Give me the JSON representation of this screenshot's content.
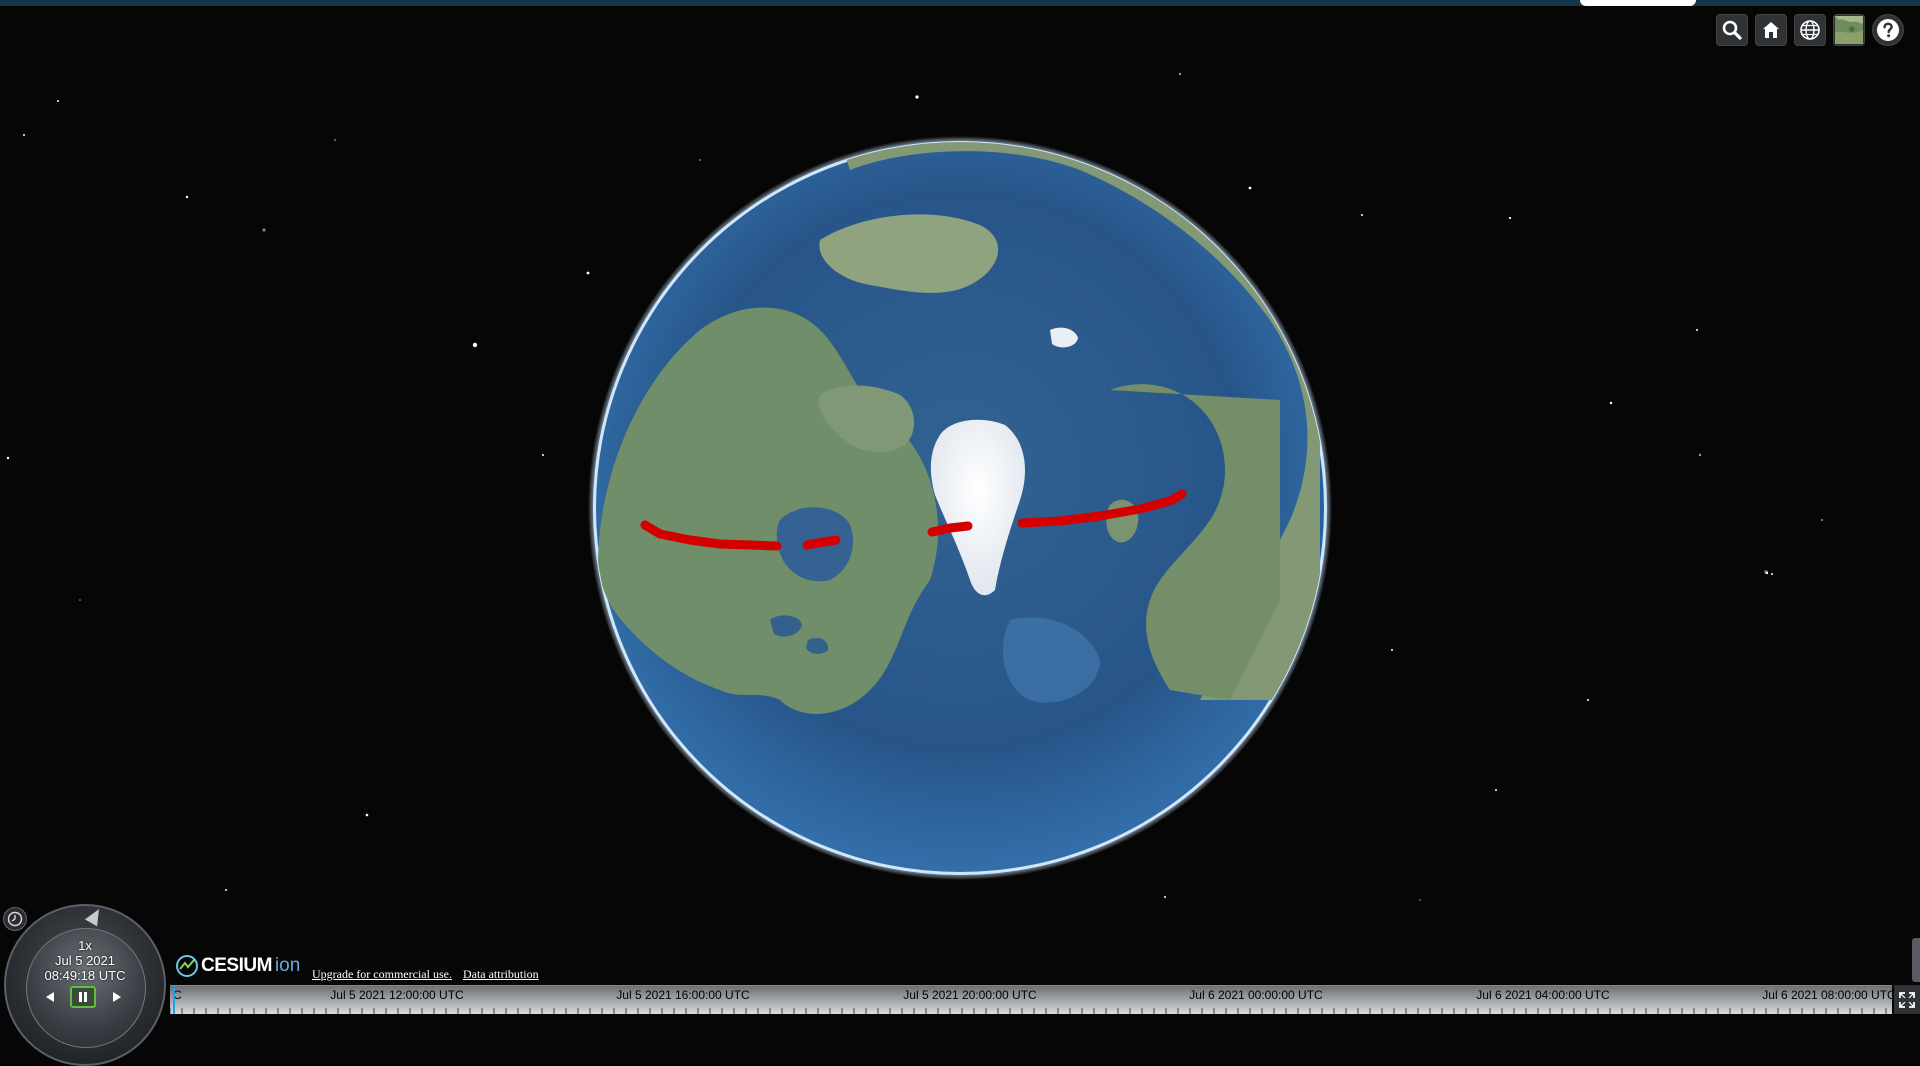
{
  "toolbar": {
    "buttons": [
      {
        "name": "search-button",
        "icon": "search-icon"
      },
      {
        "name": "home-button",
        "icon": "home-icon"
      },
      {
        "name": "scene-mode-button",
        "icon": "globe-icon"
      },
      {
        "name": "base-layer-picker-button",
        "icon": "imagery-thumbnail-icon"
      },
      {
        "name": "help-button",
        "icon": "question-icon"
      }
    ]
  },
  "animation": {
    "speed": "1x",
    "date": "Jul 5 2021",
    "time": "08:49:18 UTC"
  },
  "credits": {
    "logo_word": "CESIUM",
    "logo_suffix": "ion",
    "upgrade_link": "Upgrade for commercial use.",
    "attribution_link": "Data attribution"
  },
  "timeline": {
    "left_clipped_label": "C",
    "labels": [
      "Jul 5 2021 12:00:00 UTC",
      "Jul 5 2021 16:00:00 UTC",
      "Jul 5 2021 20:00:00 UTC",
      "Jul 6 2021 00:00:00 UTC",
      "Jul 6 2021 04:00:00 UTC",
      "Jul 6 2021 08:00:00 UTC"
    ]
  },
  "colors": {
    "track": "#d40000",
    "timeline_needle": "#1aa3f0",
    "pause_highlight": "#5fbf3f"
  }
}
